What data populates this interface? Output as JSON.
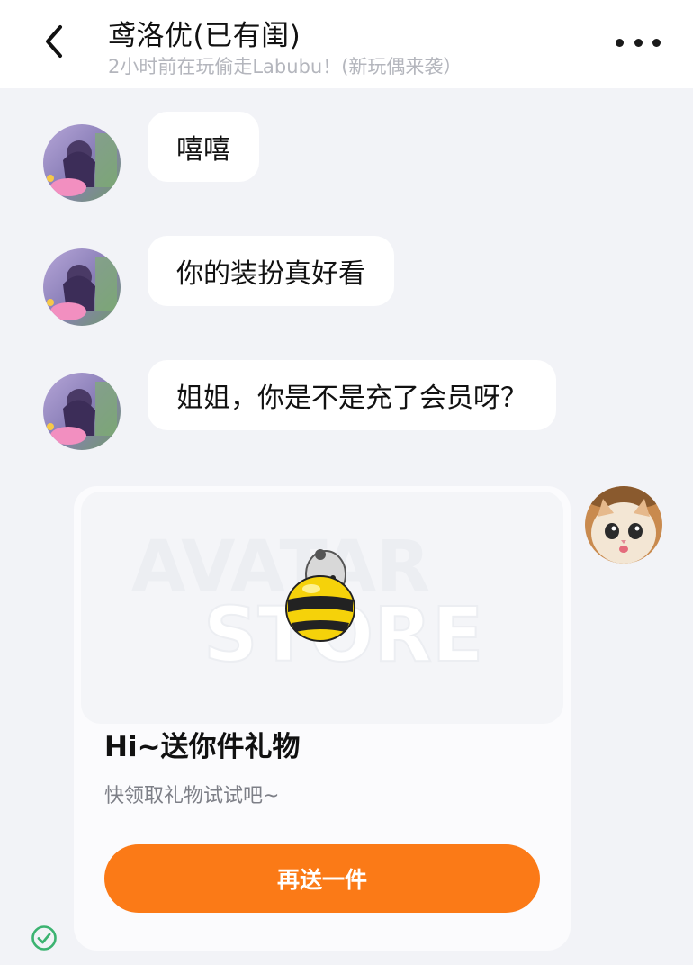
{
  "header": {
    "title": "鸢洛优(已有闺)",
    "status": "2小时前在玩偷走Labubu！(新玩偶来袭）"
  },
  "messages": [
    {
      "text": "嘻嘻"
    },
    {
      "text": "你的装扮真好看"
    },
    {
      "text": "姐姐，你是不是充了会员呀？"
    }
  ],
  "gift_card": {
    "watermark_line1": "AVATAR",
    "watermark_line2": "STORE",
    "title": "Hi~送你件礼物",
    "subtitle": "快领取礼物试试吧~",
    "button_label": "再送一件"
  },
  "colors": {
    "accent": "#fb7a17",
    "background": "#f2f3f7",
    "bubble": "#ffffff",
    "read_check": "#3cb371"
  },
  "icons": {
    "back": "chevron-left-icon",
    "more": "more-dots-icon",
    "read_status": "check-circle-icon"
  }
}
